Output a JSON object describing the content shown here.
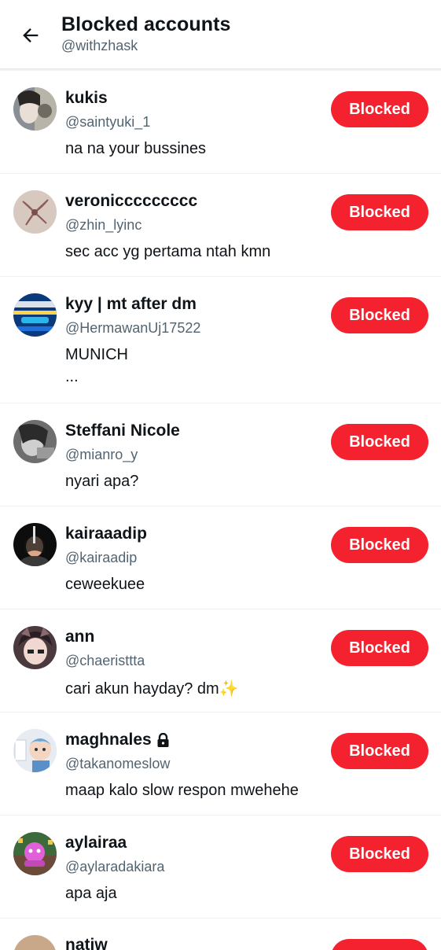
{
  "header": {
    "title": "Blocked accounts",
    "subtitle": "@withzhask",
    "back_icon": "arrow-left-icon"
  },
  "colors": {
    "accent_red": "#f4212e",
    "text_primary": "#0f1419",
    "text_secondary": "#536471",
    "divider": "#eff3f4"
  },
  "accounts": [
    {
      "name": "kukis",
      "handle": "@saintyuki_1",
      "bio": "na na your bussines",
      "button": "Blocked"
    },
    {
      "name": "veroniccccccccc",
      "handle": "@zhin_lyinc",
      "bio": "sec acc yg pertama ntah kmn",
      "button": "Blocked"
    },
    {
      "name": "kyy | mt after dm",
      "handle": "@HermawanUj17522",
      "bio": "MUNICH",
      "bio_more": "...",
      "button": "Blocked"
    },
    {
      "name": "Steffani Nicole",
      "handle": "@mianro_y",
      "bio": "nyari apa?",
      "button": "Blocked"
    },
    {
      "name": "kairaaadip",
      "handle": "@kairaadip",
      "bio": "ceweekuee",
      "button": "Blocked"
    },
    {
      "name": "ann",
      "handle": "@chaeristtta",
      "bio": "cari akun hayday? dm✨",
      "button": "Blocked"
    },
    {
      "name": "maghnales",
      "handle": "@takanomeslow",
      "bio": "maap kalo slow respon mwehehe",
      "button": "Blocked",
      "protected_icon": "lock-icon"
    },
    {
      "name": "aylairaa",
      "handle": "@aylaradakiara",
      "bio": "apa aja",
      "button": "Blocked"
    }
  ],
  "partial_account": {
    "name": "natiw"
  }
}
